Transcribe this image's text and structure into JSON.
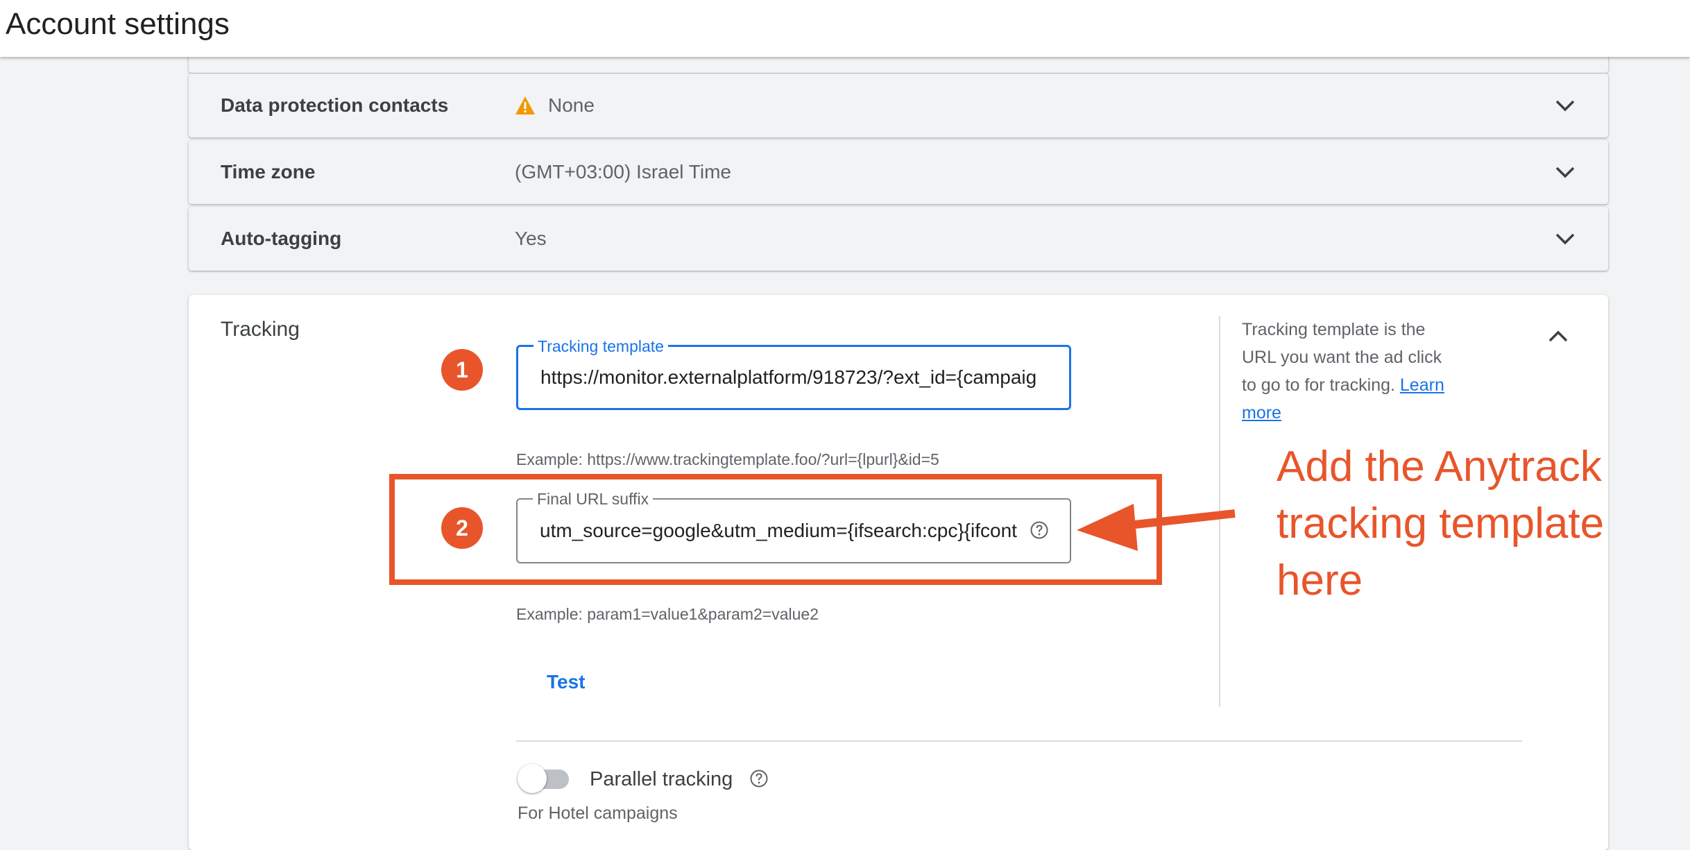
{
  "header": {
    "title": "Account settings"
  },
  "settings": [
    {
      "label": "Data protection contacts",
      "value": "None",
      "icon": "warning-icon"
    },
    {
      "label": "Time zone",
      "value": "(GMT+03:00) Israel Time"
    },
    {
      "label": "Auto-tagging",
      "value": "Yes"
    }
  ],
  "tracking": {
    "section_label": "Tracking",
    "template": {
      "badge": "1",
      "label": "Tracking template",
      "value": "https://monitor.externalplatform/918723/?ext_id={campaig",
      "example": "Example: https://www.trackingtemplate.foo/?url={lpurl}&id=5"
    },
    "suffix": {
      "badge": "2",
      "label": "Final URL suffix",
      "value": "utm_source=google&utm_medium={ifsearch:cpc}{ifcont",
      "example": "Example: param1=value1&param2=value2"
    },
    "test_label": "Test",
    "help_text": "Tracking template is the URL you want the ad click to go to for tracking.",
    "learn_more": "Learn more",
    "parallel_label": "Parallel tracking",
    "hotel_label": "For Hotel campaigns"
  },
  "annotation": {
    "lines": [
      "Add the Anytrack",
      "tracking template",
      "here"
    ],
    "color": "#e8552b"
  },
  "colors": {
    "accent": "#1a73e8",
    "annotation": "#e8552b",
    "warning": "#f29900"
  }
}
